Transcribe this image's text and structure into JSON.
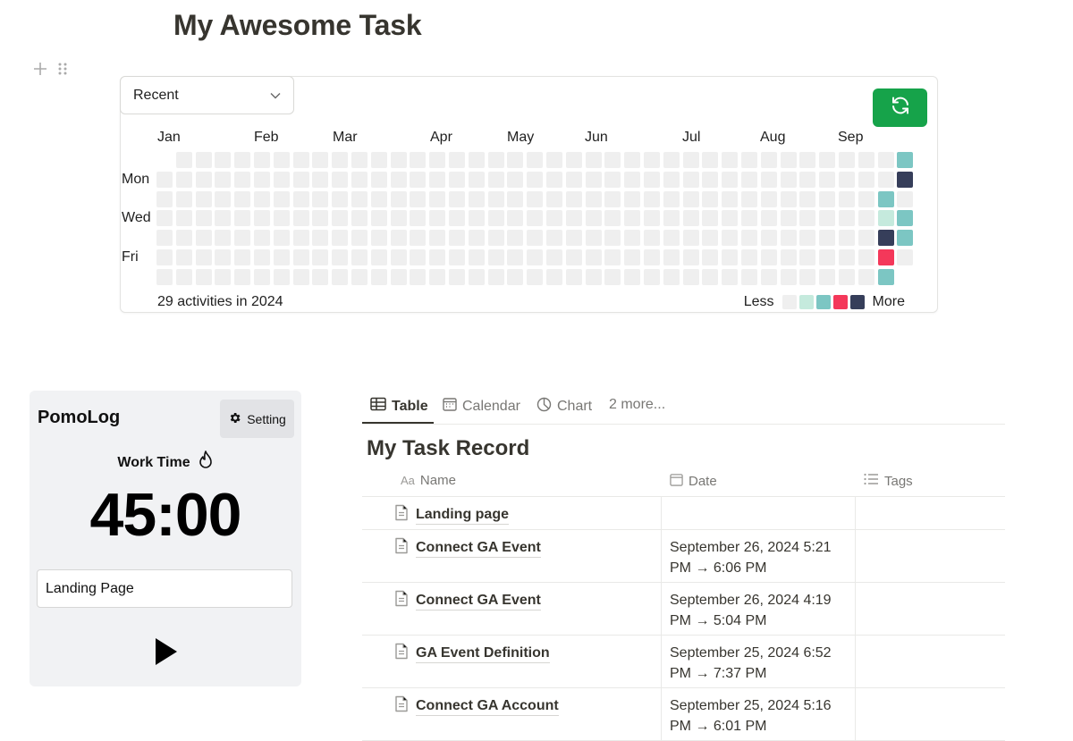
{
  "page": {
    "title": "My Awesome Task"
  },
  "heatmap": {
    "range_select": {
      "value": "Recent"
    },
    "months": [
      "Jan",
      "Feb",
      "Mar",
      "Apr",
      "May",
      "Jun",
      "Jul",
      "Aug",
      "Sep"
    ],
    "day_labels": [
      "Mon",
      "Wed",
      "Fri"
    ],
    "summary": "29 activities in 2024",
    "legend": {
      "less": "Less",
      "more": "More",
      "colors": [
        "#efefef",
        "#c5eadd",
        "#7cc6c3",
        "#f4385a",
        "#363e5a"
      ]
    },
    "active_cells": [
      {
        "week": 38,
        "day": 0,
        "level": 2
      },
      {
        "week": 38,
        "day": 1,
        "level": 4
      },
      {
        "week": 37,
        "day": 2,
        "level": 2
      },
      {
        "week": 37,
        "day": 3,
        "level": 1
      },
      {
        "week": 38,
        "day": 3,
        "level": 2
      },
      {
        "week": 37,
        "day": 4,
        "level": 4
      },
      {
        "week": 38,
        "day": 4,
        "level": 2
      },
      {
        "week": 37,
        "day": 5,
        "level": 3
      },
      {
        "week": 37,
        "day": 6,
        "level": 2
      }
    ]
  },
  "pomolog": {
    "title": "PomoLog",
    "setting_label": "Setting",
    "work_time_label": "Work Time",
    "timer": "45:00",
    "task_input_value": "Landing Page"
  },
  "database": {
    "tabs": [
      {
        "label": "Table",
        "icon": "table-icon"
      },
      {
        "label": "Calendar",
        "icon": "calendar-icon"
      },
      {
        "label": "Chart",
        "icon": "chart-icon"
      },
      {
        "label": "2 more...",
        "icon": ""
      }
    ],
    "title": "My Task Record",
    "columns": [
      {
        "label": "Name",
        "icon": "text-type-icon"
      },
      {
        "label": "Date",
        "icon": "calendar-icon"
      },
      {
        "label": "Tags",
        "icon": "list-icon"
      }
    ],
    "rows": [
      {
        "name": "Landing page",
        "date": ""
      },
      {
        "name": "Connect GA Event",
        "date": "September 26, 2024 5:21 PM → 6:06 PM"
      },
      {
        "name": "Connect GA Event",
        "date": "September 26, 2024 4:19 PM → 5:04 PM"
      },
      {
        "name": "GA Event Definition",
        "date": "September 25, 2024 6:52 PM → 7:37 PM"
      },
      {
        "name": "Connect GA Account",
        "date": "September 25, 2024 5:16 PM → 6:01 PM"
      }
    ]
  }
}
